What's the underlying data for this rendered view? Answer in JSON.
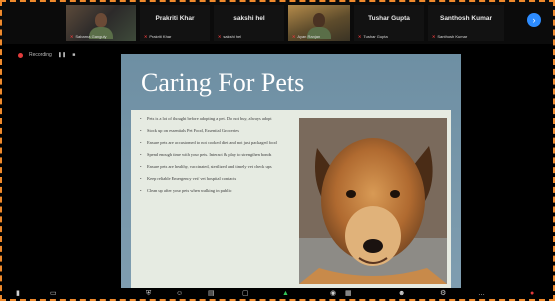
{
  "participants": [
    {
      "name": "",
      "sub": "Sabarna Ganguly",
      "video": true
    },
    {
      "name": "Prakriti Khar",
      "sub": "Prakriti Khar",
      "video": false
    },
    {
      "name": "sakshi hel",
      "sub": "sakshi hel",
      "video": false
    },
    {
      "name": "",
      "sub": "Ayan Ranjan",
      "video": true
    },
    {
      "name": "Tushar Gupta",
      "sub": "Tushar Gupta",
      "video": false
    },
    {
      "name": "Santhosh Kumar",
      "sub": "Santhosh Kumar",
      "video": false
    }
  ],
  "recording": {
    "label": "Recording"
  },
  "slide": {
    "title": "Caring For Pets",
    "bullets": [
      "Pets is a lot of thought before adopting a pet. Do not buy, always adopt",
      "Stock up on essentials Pet Food, Essential Groceries",
      "Ensure pets are accustomed to not cooked diet and not just packaged food",
      "Spend enough time with your pets. Interact & play to strengthen bonds",
      "Ensure pets are healthy, vaccinated, sterilized and timely vet check ups",
      "Keep reliable Emergency vet/ vet hospital contacts",
      "Clean up after your pets when walking in public"
    ]
  },
  "colors": {
    "accent": "#2d8cff",
    "border": "#f08a2c",
    "muted_mic": "#e23b3b"
  }
}
